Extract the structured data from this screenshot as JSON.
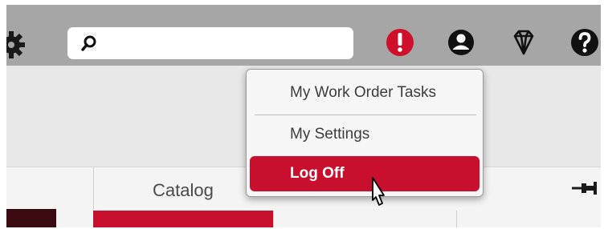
{
  "colors": {
    "accent": "#c8102e",
    "toolbar": "#a6a6a6"
  },
  "toolbar": {
    "search": {
      "placeholder": "",
      "icon": "search-icon"
    },
    "icons": [
      "gear-icon",
      "alert-icon",
      "user-icon",
      "diamond-icon",
      "help-icon"
    ]
  },
  "user_menu": {
    "items": [
      {
        "label": "My Work Order Tasks"
      },
      {
        "label": "My Settings"
      },
      {
        "label": "Log Off",
        "highlighted": true
      }
    ]
  },
  "catalog": {
    "title": "Catalog",
    "pin_icon": "pin-icon"
  }
}
